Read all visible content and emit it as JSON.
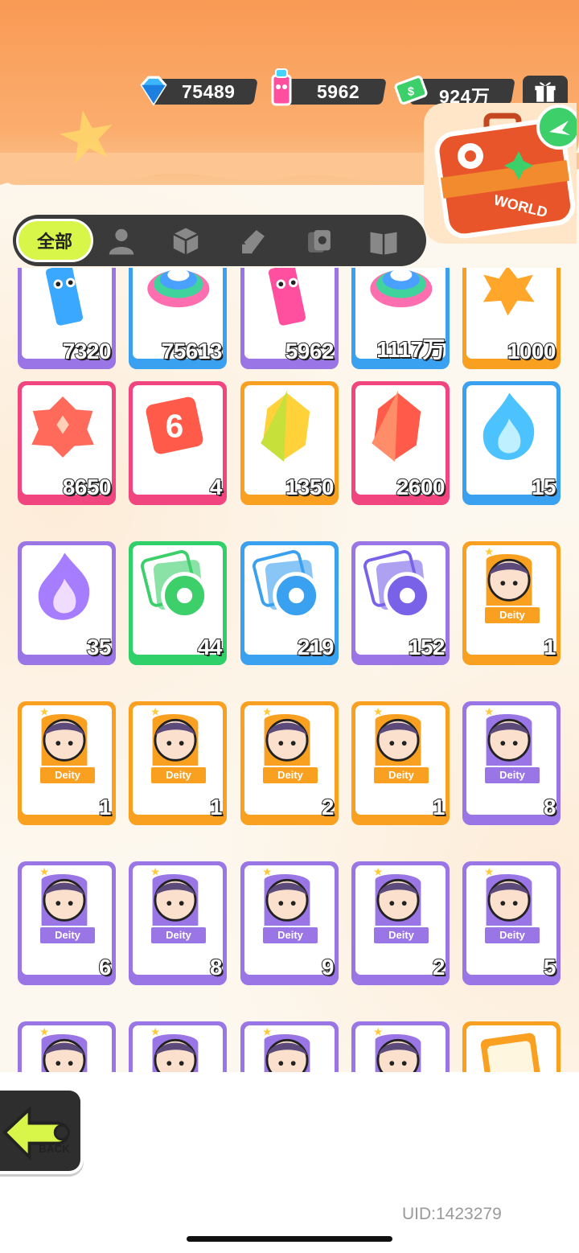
{
  "currencies": [
    {
      "icon": "blue-diamond-icon",
      "value": "75489"
    },
    {
      "icon": "spray-can-icon",
      "value": "5962"
    },
    {
      "icon": "cash-icon",
      "value": "924万"
    }
  ],
  "world_button": {
    "label": "WORLD"
  },
  "tabs": {
    "all_label": "全部",
    "icons": [
      "person-icon",
      "box-icon",
      "card-tag-icon",
      "cards-icon",
      "book-icon"
    ]
  },
  "items": [
    {
      "color": "purple",
      "icon": "blue-spray-can-icon",
      "qty": "7320"
    },
    {
      "color": "blue",
      "icon": "rainbow-swirl-icon",
      "qty": "75613"
    },
    {
      "color": "purple",
      "icon": "pink-spray-can-icon",
      "qty": "5962"
    },
    {
      "color": "blue",
      "icon": "rainbow-swirl-icon",
      "qty": "1117万"
    },
    {
      "color": "orange",
      "icon": "orange-flower-icon",
      "qty": "1000"
    },
    {
      "color": "pink",
      "icon": "red-crystal-cluster-icon",
      "qty": "8650"
    },
    {
      "color": "pink",
      "icon": "red-dice-icon",
      "qty": "4"
    },
    {
      "color": "orange",
      "icon": "yellow-gem-icon",
      "qty": "1350"
    },
    {
      "color": "pink",
      "icon": "red-gem-icon",
      "qty": "2600"
    },
    {
      "color": "blue",
      "icon": "blue-flame-icon",
      "qty": "15"
    },
    {
      "color": "purple",
      "icon": "purple-flame-icon",
      "qty": "35"
    },
    {
      "color": "green",
      "icon": "green-film-roll-icon",
      "qty": "44"
    },
    {
      "color": "blue",
      "icon": "blue-film-roll-icon",
      "qty": "219"
    },
    {
      "color": "purple",
      "icon": "purple-film-roll-icon",
      "qty": "152"
    },
    {
      "color": "orange",
      "icon": "deity-portrait-icon",
      "qty": "1",
      "badge": "Deity"
    },
    {
      "color": "orange",
      "icon": "deity-portrait-icon",
      "qty": "1",
      "badge": "Deity"
    },
    {
      "color": "orange",
      "icon": "deity-portrait-icon",
      "qty": "1",
      "badge": "Deity"
    },
    {
      "color": "orange",
      "icon": "deity-portrait-icon",
      "qty": "2",
      "badge": "Deity"
    },
    {
      "color": "orange",
      "icon": "deity-portrait-icon",
      "qty": "1",
      "badge": "Deity"
    },
    {
      "color": "purple",
      "icon": "deity-portrait-icon",
      "qty": "8",
      "badge": "Deity"
    },
    {
      "color": "purple",
      "icon": "deity-portrait-icon",
      "qty": "6",
      "badge": "Deity"
    },
    {
      "color": "purple",
      "icon": "deity-portrait-icon",
      "qty": "8",
      "badge": "Deity"
    },
    {
      "color": "purple",
      "icon": "deity-portrait-icon",
      "qty": "9",
      "badge": "Deity"
    },
    {
      "color": "purple",
      "icon": "deity-portrait-icon",
      "qty": "2",
      "badge": "Deity"
    },
    {
      "color": "purple",
      "icon": "deity-portrait-icon",
      "qty": "5",
      "badge": "Deity"
    },
    {
      "color": "purple",
      "icon": "deity-portrait-icon",
      "qty": ""
    },
    {
      "color": "purple",
      "icon": "deity-portrait-icon",
      "qty": ""
    },
    {
      "color": "purple",
      "icon": "deity-portrait-icon",
      "qty": ""
    },
    {
      "color": "purple",
      "icon": "deity-portrait-icon",
      "qty": ""
    },
    {
      "color": "orange",
      "icon": "phone-card-icon",
      "qty": ""
    }
  ],
  "back_button": {
    "label": "BACK"
  },
  "uid": "UID:1423279"
}
